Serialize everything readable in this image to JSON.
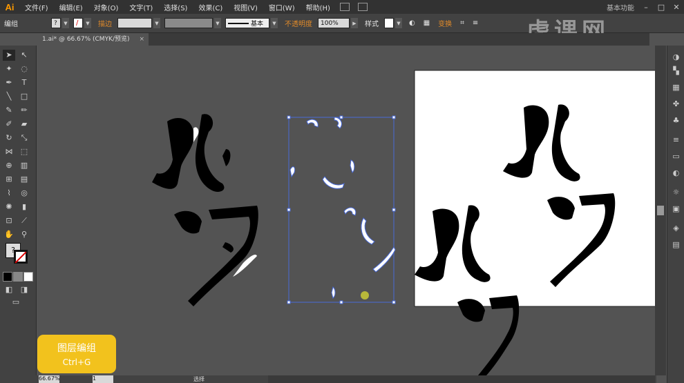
{
  "app": {
    "logo": "Ai"
  },
  "menu": [
    "文件(F)",
    "编辑(E)",
    "对象(O)",
    "文字(T)",
    "选择(S)",
    "效果(C)",
    "视图(V)",
    "窗口(W)",
    "帮助(H)"
  ],
  "workspace": "基本功能",
  "window_controls": [
    "–",
    "□",
    "✕"
  ],
  "control_bar": {
    "mode": "编组",
    "stroke_label": "描边",
    "stroke_style": "基本",
    "opacity_label": "不透明度",
    "opacity_value": "100%",
    "style_label": "样式",
    "transform_label": "变换"
  },
  "document_tab": {
    "title": "1.ai* @ 66.67% (CMYK/预览)",
    "close": "×"
  },
  "status_bar": {
    "zoom": "66.67%",
    "page": "1",
    "tool": "选择"
  },
  "shortcut_badge": {
    "title": "图层编组",
    "shortcut": "Ctrl+G"
  },
  "watermark": "虎课网",
  "artwork": {
    "char1": "龙",
    "char2": "门"
  },
  "colors": {
    "accent_orange": "#e08a2a",
    "badge_yellow": "#f2c21d",
    "selection_blue": "#4a6bd8",
    "canvas": "#535353"
  }
}
